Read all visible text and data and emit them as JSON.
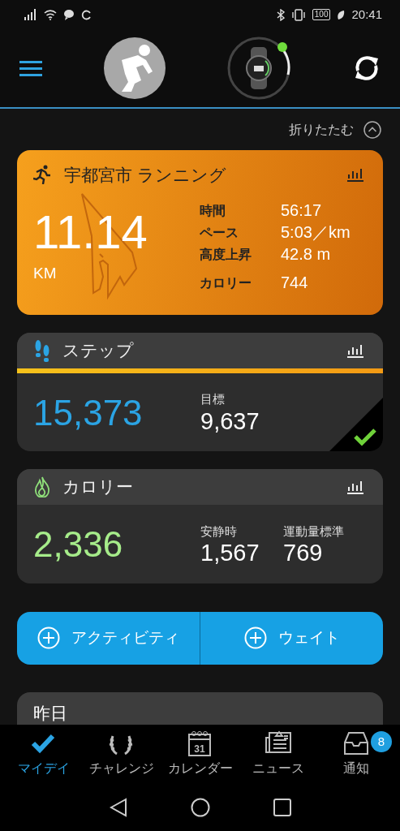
{
  "status_bar": {
    "battery": "100",
    "time": "20:41"
  },
  "collapse": {
    "label": "折りたたむ"
  },
  "activity": {
    "title": "宇都宮市 ランニング",
    "distance": "11.14",
    "unit": "KM",
    "stats": [
      {
        "label": "時間",
        "value": "56:17"
      },
      {
        "label": "ペース",
        "value": "5:03／km"
      },
      {
        "label": "高度上昇",
        "value": "42.8 m"
      },
      {
        "label": "カロリー",
        "value": "744"
      }
    ]
  },
  "steps": {
    "title": "ステップ",
    "level": 1,
    "value": "15,373",
    "goal_label": "目標",
    "goal_value": "9,637",
    "goal_met": true
  },
  "calories": {
    "title": "カロリー",
    "value": "2,336",
    "stats": [
      {
        "label": "安静時",
        "value": "1,567"
      },
      {
        "label": "運動量標準",
        "value": "769"
      }
    ]
  },
  "actions": [
    {
      "label": "アクティビティ"
    },
    {
      "label": "ウェイト"
    }
  ],
  "yesterday": {
    "title": "昨日"
  },
  "bottom_nav": [
    {
      "kind": "check",
      "label": "マイデイ",
      "selected": true
    },
    {
      "kind": "laurel",
      "label": "チャレンジ",
      "selected": false
    },
    {
      "kind": "calendar",
      "label": "カレンダー",
      "selected": false,
      "icon_text": "31"
    },
    {
      "kind": "news",
      "label": "ニュース",
      "selected": false
    },
    {
      "kind": "inbox",
      "label": "通知",
      "selected": false,
      "badge": "8"
    }
  ]
}
